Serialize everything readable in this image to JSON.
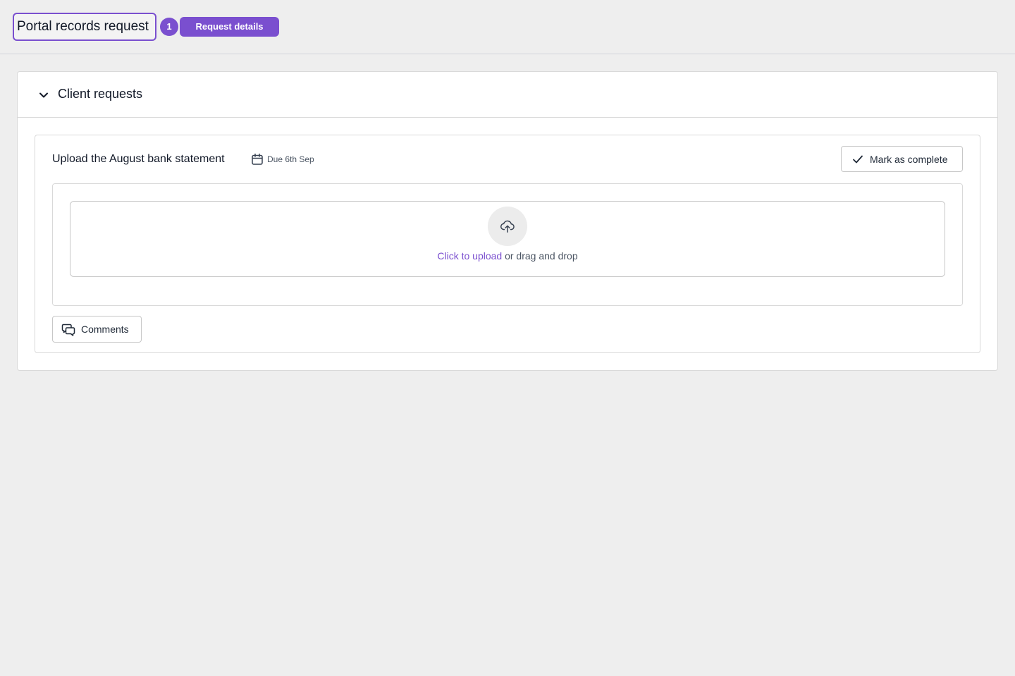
{
  "header": {
    "title": "Portal records request",
    "step_number": "1",
    "step_label": "Request details"
  },
  "section": {
    "title": "Client requests",
    "request": {
      "title": "Upload the August bank statement",
      "due": "Due 6th Sep",
      "complete_label": "Mark as complete",
      "upload_link": "Click to upload",
      "upload_rest": " or drag and drop",
      "comments_label": "Comments"
    }
  },
  "colors": {
    "accent": "#7a4fcf",
    "background": "#eeeeee"
  },
  "icons": {
    "collapse": "chevron-down-icon",
    "due": "calendar-icon",
    "complete": "check-icon",
    "upload": "cloud-upload-icon",
    "comments": "comments-icon"
  }
}
